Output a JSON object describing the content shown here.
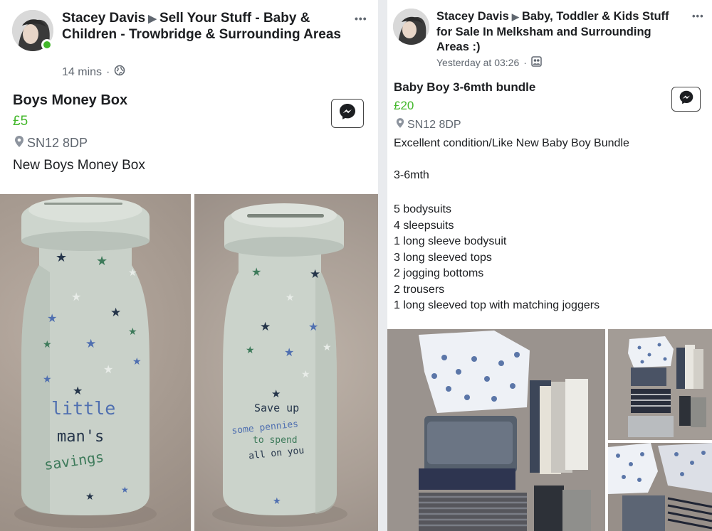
{
  "left_post": {
    "author": "Stacey Davis",
    "group": "Sell Your Stuff -  Baby & Children  - Trowbridge & Surrounding Areas",
    "time": "14 mins",
    "title": "Boys Money Box",
    "price": "£5",
    "location": "SN12 8DP",
    "description": "New Boys Money Box",
    "photo1_text": [
      "little",
      "man's",
      "savings"
    ],
    "photo2_text": [
      "Save up",
      "some pennies",
      "to spend",
      "all on you"
    ]
  },
  "right_post": {
    "author": "Stacey Davis",
    "group": "Baby, Toddler & Kids Stuff for Sale In Melksham and Surrounding Areas :)",
    "time": "Yesterday at 03:26",
    "title": "Baby Boy 3-6mth bundle",
    "price": "£20",
    "location": "SN12 8DP",
    "description_line1": "Excellent condition/Like New Baby Boy Bundle",
    "age": "3-6mth",
    "items": [
      "5 bodysuits",
      "4 sleepsuits",
      "1 long sleeve bodysuit",
      "3 long sleeved tops",
      "2 jogging bottoms",
      "2 trousers",
      "1 long sleeved top with matching joggers"
    ]
  },
  "more_label": "•••",
  "separator": "·",
  "icons": {
    "globe": "globe-icon",
    "group": "group-icon",
    "location": "location-pin-icon",
    "messenger": "messenger-icon"
  },
  "colors": {
    "price": "#42b72a",
    "online": "#42b72a",
    "meta": "#606770"
  }
}
